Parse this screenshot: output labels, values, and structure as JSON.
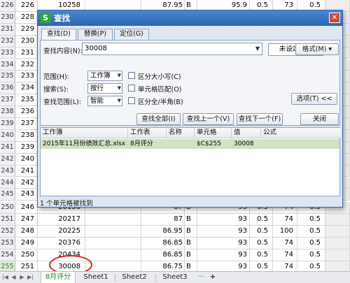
{
  "sheet": {
    "rows_top": [
      {
        "num": "226",
        "b": "10258",
        "d": "87.95",
        "e": "B",
        "f": "95.9",
        "g": "0.5",
        "h": "73",
        "i": "0.5",
        "selected": false
      },
      {
        "num": "230",
        "b": "",
        "d": "",
        "e": "",
        "f": "",
        "g": "",
        "h": "",
        "i": "",
        "selected": false
      },
      {
        "num": "231",
        "b": "",
        "d": "",
        "e": "",
        "f": "",
        "g": "",
        "h": "",
        "i": "",
        "selected": false
      },
      {
        "num": "232",
        "b": "",
        "d": "",
        "e": "",
        "f": "",
        "g": "",
        "h": "",
        "i": "",
        "selected": false
      },
      {
        "num": "233",
        "b": "",
        "d": "",
        "e": "",
        "f": "",
        "g": "",
        "h": "",
        "i": "",
        "selected": false
      },
      {
        "num": "234",
        "b": "",
        "d": "",
        "e": "",
        "f": "",
        "g": "",
        "h": "",
        "i": "",
        "selected": false
      },
      {
        "num": "235",
        "b": "",
        "d": "",
        "e": "",
        "f": "",
        "g": "",
        "h": "",
        "i": "",
        "selected": false
      },
      {
        "num": "236",
        "b": "",
        "d": "",
        "e": "",
        "f": "",
        "g": "",
        "h": "",
        "i": "",
        "selected": false
      },
      {
        "num": "237",
        "b": "",
        "d": "",
        "e": "",
        "f": "",
        "g": "",
        "h": "",
        "i": "",
        "selected": false
      },
      {
        "num": "238",
        "b": "",
        "d": "",
        "e": "",
        "f": "",
        "g": "",
        "h": "",
        "i": "",
        "selected": false
      },
      {
        "num": "239",
        "b": "",
        "d": "",
        "e": "",
        "f": "",
        "g": "",
        "h": "",
        "i": "",
        "selected": false
      },
      {
        "num": "240",
        "b": "",
        "d": "",
        "e": "",
        "f": "",
        "g": "",
        "h": "",
        "i": "",
        "selected": false
      },
      {
        "num": "241",
        "b": "",
        "d": "",
        "e": "",
        "f": "",
        "g": "",
        "h": "",
        "i": "",
        "selected": false
      },
      {
        "num": "242",
        "b": "",
        "d": "",
        "e": "",
        "f": "",
        "g": "",
        "h": "",
        "i": "",
        "selected": false
      },
      {
        "num": "243",
        "b": "",
        "d": "",
        "e": "",
        "f": "",
        "g": "",
        "h": "",
        "i": "",
        "selected": false
      },
      {
        "num": "244",
        "b": "",
        "d": "",
        "e": "",
        "f": "",
        "g": "",
        "h": "",
        "i": "",
        "selected": false
      },
      {
        "num": "245",
        "b": "",
        "d": "",
        "e": "",
        "f": "",
        "g": "",
        "h": "",
        "i": "",
        "selected": false
      }
    ],
    "left_col": [
      "226",
      "228",
      "229",
      "230",
      "231",
      "232",
      "233",
      "234",
      "235",
      "236",
      "237",
      "238",
      "239",
      "240",
      "241",
      "242",
      "243",
      "244"
    ],
    "rows_bottom": [
      {
        "num": "250",
        "a": "246",
        "b": "20156",
        "d": "87",
        "e": "B",
        "f": "93",
        "g": "0.5",
        "h": "74",
        "i": "0.5",
        "selected": false
      },
      {
        "num": "251",
        "a": "247",
        "b": "20217",
        "d": "87",
        "e": "B",
        "f": "93",
        "g": "0.5",
        "h": "74",
        "i": "0.5",
        "selected": false
      },
      {
        "num": "252",
        "a": "248",
        "b": "20225",
        "d": "86.95",
        "e": "B",
        "f": "93",
        "g": "0.5",
        "h": "100",
        "i": "0.5",
        "selected": false
      },
      {
        "num": "253",
        "a": "249",
        "b": "20376",
        "d": "86.85",
        "e": "B",
        "f": "93",
        "g": "0.5",
        "h": "74",
        "i": "0.5",
        "selected": false
      },
      {
        "num": "254",
        "a": "250",
        "b": "20434",
        "d": "86.85",
        "e": "B",
        "f": "93",
        "g": "0.5",
        "h": "74",
        "i": "0.5",
        "selected": false
      },
      {
        "num": "255",
        "a": "251",
        "b": "30008",
        "d": "86.75",
        "e": "B",
        "f": "93",
        "g": "0.5",
        "h": "74",
        "i": "0.5",
        "selected": true
      }
    ]
  },
  "dialog": {
    "app_icon": "S",
    "title": "查找",
    "close_icon": "close-icon",
    "tabs": [
      {
        "label": "查找(D)",
        "active": true
      },
      {
        "label": "替换(P)",
        "active": false
      },
      {
        "label": "定位(G)",
        "active": false
      }
    ],
    "find_label": "查找内容(N):",
    "find_value": "30008",
    "unset_format": "未设定格式",
    "format_button": "格式(M) ▾",
    "scope_label": "范围(H):",
    "scope_value": "工作簿",
    "search_label": "搜索(S):",
    "search_value": "按行",
    "lookin_label": "查找范围(L):",
    "lookin_value": "智能",
    "match_case": "区分大小写(C)",
    "match_cell": "单元格匹配(O)",
    "match_width": "区分全/半角(B)",
    "options_button": "选项(T) <<",
    "find_all": "查找全部(I)",
    "find_prev": "查找上一个(V)",
    "find_next": "查找下一个(F)",
    "close_button": "关闭",
    "results_headers": [
      "工作簿",
      "工作表",
      "名称",
      "单元格",
      "值",
      "公式"
    ],
    "result": {
      "workbook": "2015年11月份绩效汇总.xlsx",
      "sheet": "8月评分",
      "name": "",
      "cell": "$C$255",
      "value": "30008",
      "formula": ""
    },
    "status": "1 个单元格被找到"
  },
  "tabs": {
    "nav": [
      "|◀",
      "◀",
      "▶",
      "▶|"
    ],
    "sheets": [
      {
        "label": "8月评分",
        "active": true
      },
      {
        "label": "Sheet1",
        "active": false
      },
      {
        "label": "Sheet2",
        "active": false
      },
      {
        "label": "Sheet3",
        "active": false
      }
    ],
    "more": "···",
    "add": "+"
  },
  "colors": {
    "accent_green": "#1f8a1f",
    "highlight_red": "#d42020",
    "title_blue": "#2b66b4"
  }
}
